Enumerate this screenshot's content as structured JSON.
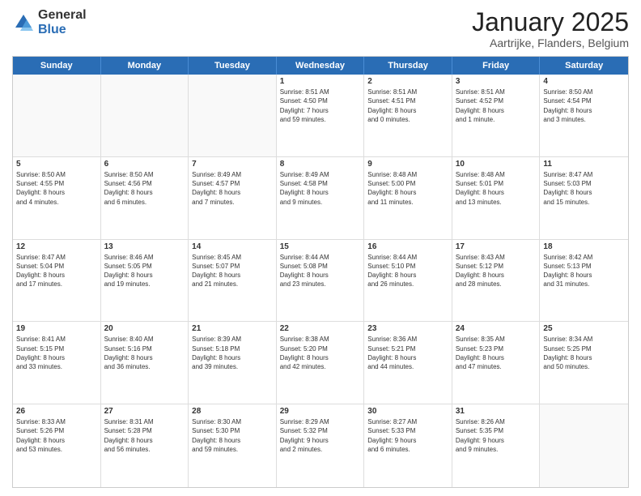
{
  "header": {
    "logo_general": "General",
    "logo_blue": "Blue",
    "title": "January 2025",
    "location": "Aartrijke, Flanders, Belgium"
  },
  "weekdays": [
    "Sunday",
    "Monday",
    "Tuesday",
    "Wednesday",
    "Thursday",
    "Friday",
    "Saturday"
  ],
  "weeks": [
    [
      {
        "day": "",
        "lines": []
      },
      {
        "day": "",
        "lines": []
      },
      {
        "day": "",
        "lines": []
      },
      {
        "day": "1",
        "lines": [
          "Sunrise: 8:51 AM",
          "Sunset: 4:50 PM",
          "Daylight: 7 hours",
          "and 59 minutes."
        ]
      },
      {
        "day": "2",
        "lines": [
          "Sunrise: 8:51 AM",
          "Sunset: 4:51 PM",
          "Daylight: 8 hours",
          "and 0 minutes."
        ]
      },
      {
        "day": "3",
        "lines": [
          "Sunrise: 8:51 AM",
          "Sunset: 4:52 PM",
          "Daylight: 8 hours",
          "and 1 minute."
        ]
      },
      {
        "day": "4",
        "lines": [
          "Sunrise: 8:50 AM",
          "Sunset: 4:54 PM",
          "Daylight: 8 hours",
          "and 3 minutes."
        ]
      }
    ],
    [
      {
        "day": "5",
        "lines": [
          "Sunrise: 8:50 AM",
          "Sunset: 4:55 PM",
          "Daylight: 8 hours",
          "and 4 minutes."
        ]
      },
      {
        "day": "6",
        "lines": [
          "Sunrise: 8:50 AM",
          "Sunset: 4:56 PM",
          "Daylight: 8 hours",
          "and 6 minutes."
        ]
      },
      {
        "day": "7",
        "lines": [
          "Sunrise: 8:49 AM",
          "Sunset: 4:57 PM",
          "Daylight: 8 hours",
          "and 7 minutes."
        ]
      },
      {
        "day": "8",
        "lines": [
          "Sunrise: 8:49 AM",
          "Sunset: 4:58 PM",
          "Daylight: 8 hours",
          "and 9 minutes."
        ]
      },
      {
        "day": "9",
        "lines": [
          "Sunrise: 8:48 AM",
          "Sunset: 5:00 PM",
          "Daylight: 8 hours",
          "and 11 minutes."
        ]
      },
      {
        "day": "10",
        "lines": [
          "Sunrise: 8:48 AM",
          "Sunset: 5:01 PM",
          "Daylight: 8 hours",
          "and 13 minutes."
        ]
      },
      {
        "day": "11",
        "lines": [
          "Sunrise: 8:47 AM",
          "Sunset: 5:03 PM",
          "Daylight: 8 hours",
          "and 15 minutes."
        ]
      }
    ],
    [
      {
        "day": "12",
        "lines": [
          "Sunrise: 8:47 AM",
          "Sunset: 5:04 PM",
          "Daylight: 8 hours",
          "and 17 minutes."
        ]
      },
      {
        "day": "13",
        "lines": [
          "Sunrise: 8:46 AM",
          "Sunset: 5:05 PM",
          "Daylight: 8 hours",
          "and 19 minutes."
        ]
      },
      {
        "day": "14",
        "lines": [
          "Sunrise: 8:45 AM",
          "Sunset: 5:07 PM",
          "Daylight: 8 hours",
          "and 21 minutes."
        ]
      },
      {
        "day": "15",
        "lines": [
          "Sunrise: 8:44 AM",
          "Sunset: 5:08 PM",
          "Daylight: 8 hours",
          "and 23 minutes."
        ]
      },
      {
        "day": "16",
        "lines": [
          "Sunrise: 8:44 AM",
          "Sunset: 5:10 PM",
          "Daylight: 8 hours",
          "and 26 minutes."
        ]
      },
      {
        "day": "17",
        "lines": [
          "Sunrise: 8:43 AM",
          "Sunset: 5:12 PM",
          "Daylight: 8 hours",
          "and 28 minutes."
        ]
      },
      {
        "day": "18",
        "lines": [
          "Sunrise: 8:42 AM",
          "Sunset: 5:13 PM",
          "Daylight: 8 hours",
          "and 31 minutes."
        ]
      }
    ],
    [
      {
        "day": "19",
        "lines": [
          "Sunrise: 8:41 AM",
          "Sunset: 5:15 PM",
          "Daylight: 8 hours",
          "and 33 minutes."
        ]
      },
      {
        "day": "20",
        "lines": [
          "Sunrise: 8:40 AM",
          "Sunset: 5:16 PM",
          "Daylight: 8 hours",
          "and 36 minutes."
        ]
      },
      {
        "day": "21",
        "lines": [
          "Sunrise: 8:39 AM",
          "Sunset: 5:18 PM",
          "Daylight: 8 hours",
          "and 39 minutes."
        ]
      },
      {
        "day": "22",
        "lines": [
          "Sunrise: 8:38 AM",
          "Sunset: 5:20 PM",
          "Daylight: 8 hours",
          "and 42 minutes."
        ]
      },
      {
        "day": "23",
        "lines": [
          "Sunrise: 8:36 AM",
          "Sunset: 5:21 PM",
          "Daylight: 8 hours",
          "and 44 minutes."
        ]
      },
      {
        "day": "24",
        "lines": [
          "Sunrise: 8:35 AM",
          "Sunset: 5:23 PM",
          "Daylight: 8 hours",
          "and 47 minutes."
        ]
      },
      {
        "day": "25",
        "lines": [
          "Sunrise: 8:34 AM",
          "Sunset: 5:25 PM",
          "Daylight: 8 hours",
          "and 50 minutes."
        ]
      }
    ],
    [
      {
        "day": "26",
        "lines": [
          "Sunrise: 8:33 AM",
          "Sunset: 5:26 PM",
          "Daylight: 8 hours",
          "and 53 minutes."
        ]
      },
      {
        "day": "27",
        "lines": [
          "Sunrise: 8:31 AM",
          "Sunset: 5:28 PM",
          "Daylight: 8 hours",
          "and 56 minutes."
        ]
      },
      {
        "day": "28",
        "lines": [
          "Sunrise: 8:30 AM",
          "Sunset: 5:30 PM",
          "Daylight: 8 hours",
          "and 59 minutes."
        ]
      },
      {
        "day": "29",
        "lines": [
          "Sunrise: 8:29 AM",
          "Sunset: 5:32 PM",
          "Daylight: 9 hours",
          "and 2 minutes."
        ]
      },
      {
        "day": "30",
        "lines": [
          "Sunrise: 8:27 AM",
          "Sunset: 5:33 PM",
          "Daylight: 9 hours",
          "and 6 minutes."
        ]
      },
      {
        "day": "31",
        "lines": [
          "Sunrise: 8:26 AM",
          "Sunset: 5:35 PM",
          "Daylight: 9 hours",
          "and 9 minutes."
        ]
      },
      {
        "day": "",
        "lines": []
      }
    ]
  ]
}
